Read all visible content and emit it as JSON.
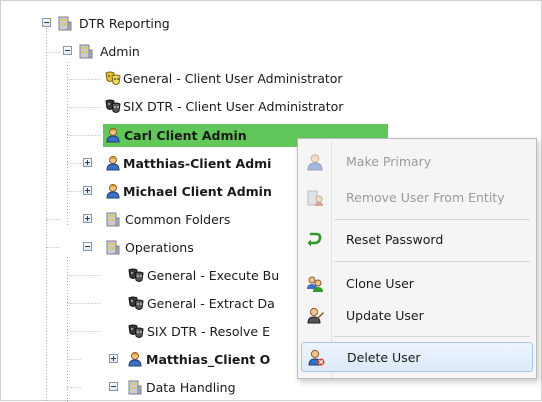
{
  "tree": {
    "nodes": [
      {
        "label": "DTR Reporting",
        "icon": "building-icon"
      },
      {
        "label": "Admin",
        "icon": "building-icon"
      },
      {
        "label": "General - Client User Administrator",
        "icon": "role-mask-gold-icon"
      },
      {
        "label": "SIX DTR - Client User Administrator",
        "icon": "role-mask-dark-icon"
      },
      {
        "label": "Carl Client Admin",
        "icon": "user-icon",
        "selected": true
      },
      {
        "label": "Matthias-Client Admi",
        "icon": "user-icon"
      },
      {
        "label": "Michael Client Admin",
        "icon": "user-icon"
      },
      {
        "label": "Common Folders",
        "icon": "building-icon"
      },
      {
        "label": "Operations",
        "icon": "building-icon"
      },
      {
        "label": "General - Execute Bu",
        "icon": "role-mask-dark-icon"
      },
      {
        "label": "General - Extract Da",
        "icon": "role-mask-dark-icon"
      },
      {
        "label": "SIX DTR - Resolve E",
        "icon": "role-mask-dark-icon"
      },
      {
        "label": "Matthias_Client O",
        "icon": "user-icon"
      },
      {
        "label": "Data Handling",
        "icon": "building-icon"
      }
    ]
  },
  "context_menu": {
    "items": [
      {
        "label": "Make Primary",
        "icon": "user-star-icon",
        "enabled": false
      },
      {
        "label": "Remove User From Entity",
        "icon": "remove-user-icon",
        "enabled": false
      },
      {
        "label": "Reset Password",
        "icon": "green-arrow-icon",
        "enabled": true
      },
      {
        "label": "Clone User",
        "icon": "clone-user-icon",
        "enabled": true
      },
      {
        "label": "Update User",
        "icon": "update-user-icon",
        "enabled": true
      },
      {
        "label": "Delete User",
        "icon": "delete-user-icon",
        "enabled": true,
        "hovered": true
      }
    ]
  },
  "colors": {
    "selection": "#62c75a",
    "menu_hover": "#dce9f8",
    "disabled_text": "#9a9a9a"
  }
}
